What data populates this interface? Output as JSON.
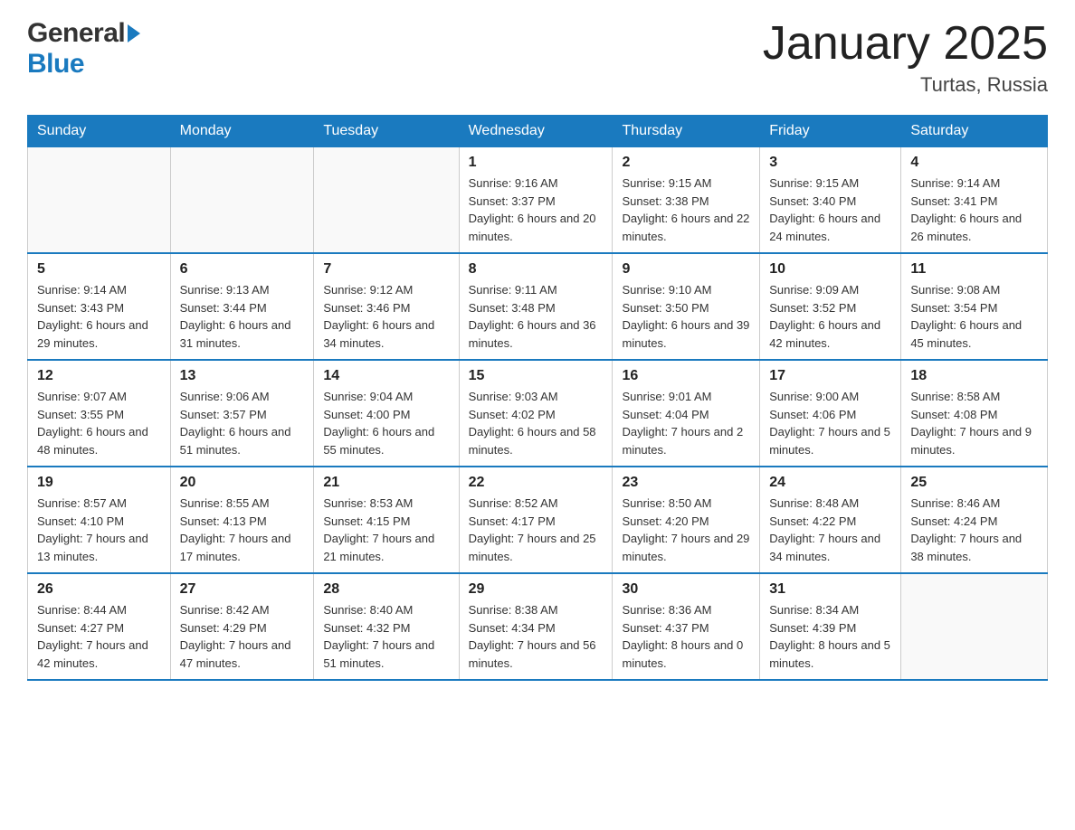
{
  "header": {
    "logo_general": "General",
    "logo_blue": "Blue",
    "month_title": "January 2025",
    "location": "Turtas, Russia"
  },
  "days_of_week": [
    "Sunday",
    "Monday",
    "Tuesday",
    "Wednesday",
    "Thursday",
    "Friday",
    "Saturday"
  ],
  "weeks": [
    [
      {
        "day": "",
        "sunrise": "",
        "sunset": "",
        "daylight": ""
      },
      {
        "day": "",
        "sunrise": "",
        "sunset": "",
        "daylight": ""
      },
      {
        "day": "",
        "sunrise": "",
        "sunset": "",
        "daylight": ""
      },
      {
        "day": "1",
        "sunrise": "Sunrise: 9:16 AM",
        "sunset": "Sunset: 3:37 PM",
        "daylight": "Daylight: 6 hours and 20 minutes."
      },
      {
        "day": "2",
        "sunrise": "Sunrise: 9:15 AM",
        "sunset": "Sunset: 3:38 PM",
        "daylight": "Daylight: 6 hours and 22 minutes."
      },
      {
        "day": "3",
        "sunrise": "Sunrise: 9:15 AM",
        "sunset": "Sunset: 3:40 PM",
        "daylight": "Daylight: 6 hours and 24 minutes."
      },
      {
        "day": "4",
        "sunrise": "Sunrise: 9:14 AM",
        "sunset": "Sunset: 3:41 PM",
        "daylight": "Daylight: 6 hours and 26 minutes."
      }
    ],
    [
      {
        "day": "5",
        "sunrise": "Sunrise: 9:14 AM",
        "sunset": "Sunset: 3:43 PM",
        "daylight": "Daylight: 6 hours and 29 minutes."
      },
      {
        "day": "6",
        "sunrise": "Sunrise: 9:13 AM",
        "sunset": "Sunset: 3:44 PM",
        "daylight": "Daylight: 6 hours and 31 minutes."
      },
      {
        "day": "7",
        "sunrise": "Sunrise: 9:12 AM",
        "sunset": "Sunset: 3:46 PM",
        "daylight": "Daylight: 6 hours and 34 minutes."
      },
      {
        "day": "8",
        "sunrise": "Sunrise: 9:11 AM",
        "sunset": "Sunset: 3:48 PM",
        "daylight": "Daylight: 6 hours and 36 minutes."
      },
      {
        "day": "9",
        "sunrise": "Sunrise: 9:10 AM",
        "sunset": "Sunset: 3:50 PM",
        "daylight": "Daylight: 6 hours and 39 minutes."
      },
      {
        "day": "10",
        "sunrise": "Sunrise: 9:09 AM",
        "sunset": "Sunset: 3:52 PM",
        "daylight": "Daylight: 6 hours and 42 minutes."
      },
      {
        "day": "11",
        "sunrise": "Sunrise: 9:08 AM",
        "sunset": "Sunset: 3:54 PM",
        "daylight": "Daylight: 6 hours and 45 minutes."
      }
    ],
    [
      {
        "day": "12",
        "sunrise": "Sunrise: 9:07 AM",
        "sunset": "Sunset: 3:55 PM",
        "daylight": "Daylight: 6 hours and 48 minutes."
      },
      {
        "day": "13",
        "sunrise": "Sunrise: 9:06 AM",
        "sunset": "Sunset: 3:57 PM",
        "daylight": "Daylight: 6 hours and 51 minutes."
      },
      {
        "day": "14",
        "sunrise": "Sunrise: 9:04 AM",
        "sunset": "Sunset: 4:00 PM",
        "daylight": "Daylight: 6 hours and 55 minutes."
      },
      {
        "day": "15",
        "sunrise": "Sunrise: 9:03 AM",
        "sunset": "Sunset: 4:02 PM",
        "daylight": "Daylight: 6 hours and 58 minutes."
      },
      {
        "day": "16",
        "sunrise": "Sunrise: 9:01 AM",
        "sunset": "Sunset: 4:04 PM",
        "daylight": "Daylight: 7 hours and 2 minutes."
      },
      {
        "day": "17",
        "sunrise": "Sunrise: 9:00 AM",
        "sunset": "Sunset: 4:06 PM",
        "daylight": "Daylight: 7 hours and 5 minutes."
      },
      {
        "day": "18",
        "sunrise": "Sunrise: 8:58 AM",
        "sunset": "Sunset: 4:08 PM",
        "daylight": "Daylight: 7 hours and 9 minutes."
      }
    ],
    [
      {
        "day": "19",
        "sunrise": "Sunrise: 8:57 AM",
        "sunset": "Sunset: 4:10 PM",
        "daylight": "Daylight: 7 hours and 13 minutes."
      },
      {
        "day": "20",
        "sunrise": "Sunrise: 8:55 AM",
        "sunset": "Sunset: 4:13 PM",
        "daylight": "Daylight: 7 hours and 17 minutes."
      },
      {
        "day": "21",
        "sunrise": "Sunrise: 8:53 AM",
        "sunset": "Sunset: 4:15 PM",
        "daylight": "Daylight: 7 hours and 21 minutes."
      },
      {
        "day": "22",
        "sunrise": "Sunrise: 8:52 AM",
        "sunset": "Sunset: 4:17 PM",
        "daylight": "Daylight: 7 hours and 25 minutes."
      },
      {
        "day": "23",
        "sunrise": "Sunrise: 8:50 AM",
        "sunset": "Sunset: 4:20 PM",
        "daylight": "Daylight: 7 hours and 29 minutes."
      },
      {
        "day": "24",
        "sunrise": "Sunrise: 8:48 AM",
        "sunset": "Sunset: 4:22 PM",
        "daylight": "Daylight: 7 hours and 34 minutes."
      },
      {
        "day": "25",
        "sunrise": "Sunrise: 8:46 AM",
        "sunset": "Sunset: 4:24 PM",
        "daylight": "Daylight: 7 hours and 38 minutes."
      }
    ],
    [
      {
        "day": "26",
        "sunrise": "Sunrise: 8:44 AM",
        "sunset": "Sunset: 4:27 PM",
        "daylight": "Daylight: 7 hours and 42 minutes."
      },
      {
        "day": "27",
        "sunrise": "Sunrise: 8:42 AM",
        "sunset": "Sunset: 4:29 PM",
        "daylight": "Daylight: 7 hours and 47 minutes."
      },
      {
        "day": "28",
        "sunrise": "Sunrise: 8:40 AM",
        "sunset": "Sunset: 4:32 PM",
        "daylight": "Daylight: 7 hours and 51 minutes."
      },
      {
        "day": "29",
        "sunrise": "Sunrise: 8:38 AM",
        "sunset": "Sunset: 4:34 PM",
        "daylight": "Daylight: 7 hours and 56 minutes."
      },
      {
        "day": "30",
        "sunrise": "Sunrise: 8:36 AM",
        "sunset": "Sunset: 4:37 PM",
        "daylight": "Daylight: 8 hours and 0 minutes."
      },
      {
        "day": "31",
        "sunrise": "Sunrise: 8:34 AM",
        "sunset": "Sunset: 4:39 PM",
        "daylight": "Daylight: 8 hours and 5 minutes."
      },
      {
        "day": "",
        "sunrise": "",
        "sunset": "",
        "daylight": ""
      }
    ]
  ]
}
